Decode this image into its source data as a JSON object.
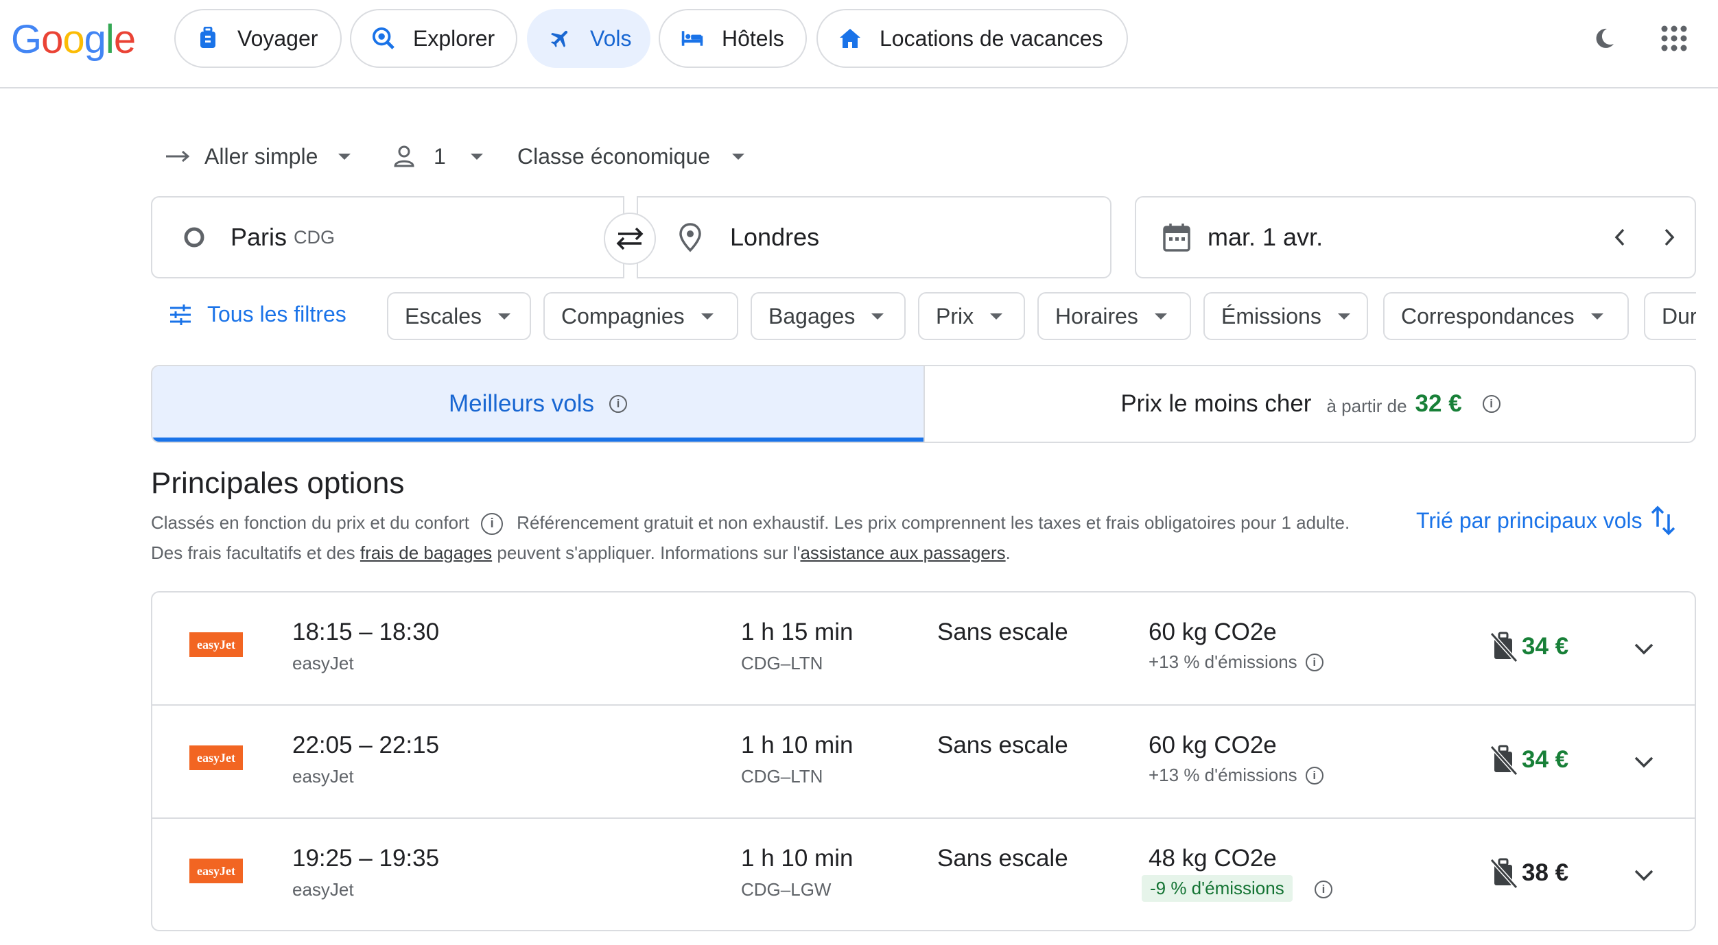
{
  "header": {
    "logo": [
      "G",
      "o",
      "o",
      "g",
      "l",
      "e"
    ],
    "logo_colors": [
      "#4285f4",
      "#ea4335",
      "#fbbc05",
      "#4285f4",
      "#34a853",
      "#ea4335"
    ],
    "nav": [
      {
        "label": "Voyager",
        "icon": "luggage-icon"
      },
      {
        "label": "Explorer",
        "icon": "explore-icon"
      },
      {
        "label": "Vols",
        "icon": "airplane-icon",
        "active": true
      },
      {
        "label": "Hôtels",
        "icon": "bed-icon"
      },
      {
        "label": "Locations de vacances",
        "icon": "house-icon"
      }
    ],
    "right_icons": [
      "dark-mode-icon",
      "apps-grid-icon"
    ]
  },
  "trip_options": {
    "trip_type": "Aller simple",
    "passengers": "1",
    "cabin_class": "Classe économique"
  },
  "search": {
    "origin": "Paris",
    "origin_code": "CDG",
    "destination": "Londres",
    "date": "mar. 1 avr."
  },
  "filters": {
    "all_filters": "Tous les filtres",
    "chips": [
      "Escales",
      "Compagnies",
      "Bagages",
      "Prix",
      "Horaires",
      "Émissions",
      "Correspondances",
      "Dur"
    ]
  },
  "tabs": {
    "best": "Meilleurs vols",
    "cheapest": "Prix le moins cher",
    "cheapest_prefix": "à partir de",
    "cheapest_price": "32 €"
  },
  "section": {
    "title": "Principales options",
    "ranked": "Classés en fonction du prix et du confort",
    "disclaimer_1": "Référencement gratuit et non exhaustif. Les prix comprennent les taxes et frais obligatoires pour 1 adulte. Des frais facultatifs et des ",
    "baggage_link": "frais de bagages",
    "disclaimer_2": " peuvent s'appliquer. Informations sur l'",
    "assist_link": "assistance aux passagers",
    "disclaimer_3": ".",
    "sorted_by": "Trié par principaux vols"
  },
  "results": [
    {
      "times": "18:15 – 18:30",
      "airline": "easyJet",
      "logo_text": "easyJet",
      "duration": "1 h 15 min",
      "route": "CDG–LTN",
      "stops": "Sans escale",
      "co2": "60 kg CO2e",
      "emissions": "+13 % d'émissions",
      "emissions_good": false,
      "price": "34 €",
      "price_color": "#188038"
    },
    {
      "times": "22:05 – 22:15",
      "airline": "easyJet",
      "logo_text": "easyJet",
      "duration": "1 h 10 min",
      "route": "CDG–LTN",
      "stops": "Sans escale",
      "co2": "60 kg CO2e",
      "emissions": "+13 % d'émissions",
      "emissions_good": false,
      "price": "34 €",
      "price_color": "#188038"
    },
    {
      "times": "19:25 – 19:35",
      "airline": "easyJet",
      "logo_text": "easyJet",
      "duration": "1 h 10 min",
      "route": "CDG–LGW",
      "stops": "Sans escale",
      "co2": "48 kg CO2e",
      "emissions": "-9 % d'émissions",
      "emissions_good": true,
      "price": "38 €",
      "price_color": "#202124"
    }
  ]
}
